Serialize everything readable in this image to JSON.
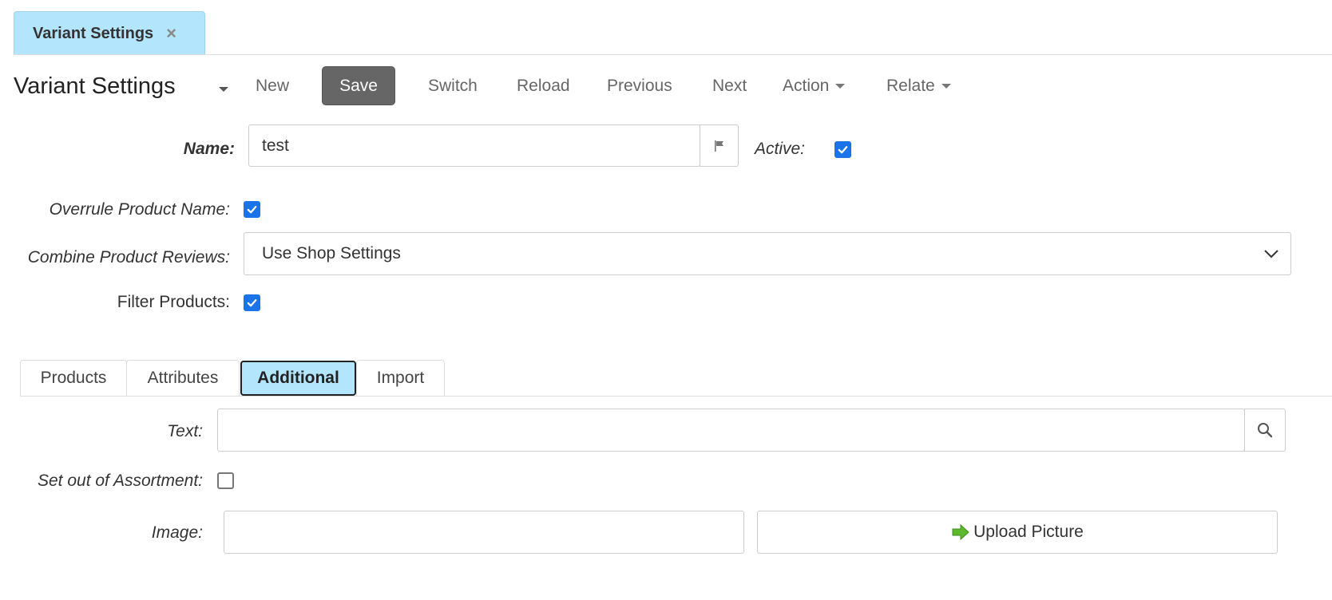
{
  "tab": {
    "title": "Variant Settings",
    "close_icon": "×"
  },
  "toolbar": {
    "title": "Variant Settings",
    "buttons": {
      "new": "New",
      "save": "Save",
      "switch": "Switch",
      "reload": "Reload",
      "previous": "Previous",
      "next": "Next",
      "action": "Action",
      "relate": "Relate"
    }
  },
  "form": {
    "name_label": "Name:",
    "name_value": "test",
    "active_label": "Active:",
    "active_checked": true,
    "overrule_label": "Overrule Product Name:",
    "overrule_checked": true,
    "combine_label": "Combine Product Reviews:",
    "combine_value": "Use Shop Settings",
    "filter_label": "Filter Products:",
    "filter_checked": true
  },
  "tabs": {
    "products": "Products",
    "attributes": "Attributes",
    "additional": "Additional",
    "import": "Import",
    "active": "Additional"
  },
  "additional": {
    "text_label": "Text:",
    "text_value": "",
    "assortment_label": "Set out of Assortment:",
    "assortment_checked": false,
    "image_label": "Image:",
    "image_value": "",
    "upload_label": "Upload Picture"
  },
  "colors": {
    "accent": "#1a73e8",
    "tab_active": "#b3e5fc",
    "save_button": "#666666"
  },
  "icons": {
    "flag": "flag-icon",
    "search": "search-icon",
    "upload": "arrow-right-icon",
    "dropdown": "chevron-down-icon"
  }
}
